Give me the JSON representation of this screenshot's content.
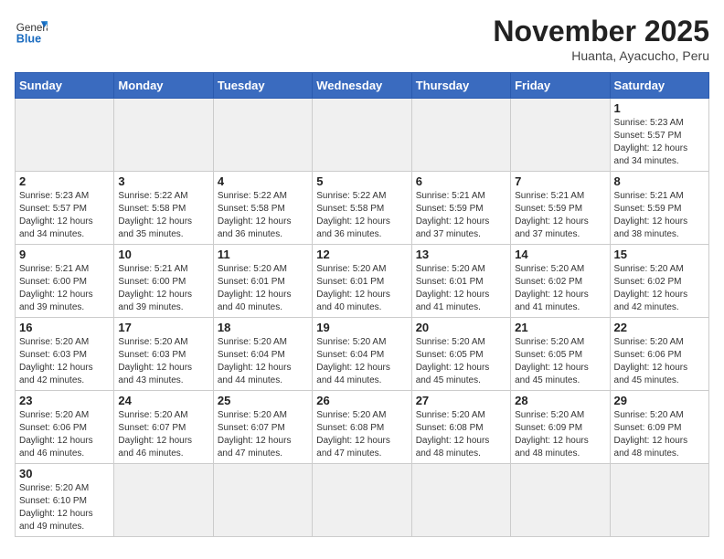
{
  "header": {
    "logo_general": "General",
    "logo_blue": "Blue",
    "month_title": "November 2025",
    "subtitle": "Huanta, Ayacucho, Peru"
  },
  "days_of_week": [
    "Sunday",
    "Monday",
    "Tuesday",
    "Wednesday",
    "Thursday",
    "Friday",
    "Saturday"
  ],
  "weeks": [
    [
      {
        "day": "",
        "info": ""
      },
      {
        "day": "",
        "info": ""
      },
      {
        "day": "",
        "info": ""
      },
      {
        "day": "",
        "info": ""
      },
      {
        "day": "",
        "info": ""
      },
      {
        "day": "",
        "info": ""
      },
      {
        "day": "1",
        "info": "Sunrise: 5:23 AM\nSunset: 5:57 PM\nDaylight: 12 hours and 34 minutes."
      }
    ],
    [
      {
        "day": "2",
        "info": "Sunrise: 5:23 AM\nSunset: 5:57 PM\nDaylight: 12 hours and 34 minutes."
      },
      {
        "day": "3",
        "info": "Sunrise: 5:22 AM\nSunset: 5:58 PM\nDaylight: 12 hours and 35 minutes."
      },
      {
        "day": "4",
        "info": "Sunrise: 5:22 AM\nSunset: 5:58 PM\nDaylight: 12 hours and 36 minutes."
      },
      {
        "day": "5",
        "info": "Sunrise: 5:22 AM\nSunset: 5:58 PM\nDaylight: 12 hours and 36 minutes."
      },
      {
        "day": "6",
        "info": "Sunrise: 5:21 AM\nSunset: 5:59 PM\nDaylight: 12 hours and 37 minutes."
      },
      {
        "day": "7",
        "info": "Sunrise: 5:21 AM\nSunset: 5:59 PM\nDaylight: 12 hours and 37 minutes."
      },
      {
        "day": "8",
        "info": "Sunrise: 5:21 AM\nSunset: 5:59 PM\nDaylight: 12 hours and 38 minutes."
      }
    ],
    [
      {
        "day": "9",
        "info": "Sunrise: 5:21 AM\nSunset: 6:00 PM\nDaylight: 12 hours and 39 minutes."
      },
      {
        "day": "10",
        "info": "Sunrise: 5:21 AM\nSunset: 6:00 PM\nDaylight: 12 hours and 39 minutes."
      },
      {
        "day": "11",
        "info": "Sunrise: 5:20 AM\nSunset: 6:01 PM\nDaylight: 12 hours and 40 minutes."
      },
      {
        "day": "12",
        "info": "Sunrise: 5:20 AM\nSunset: 6:01 PM\nDaylight: 12 hours and 40 minutes."
      },
      {
        "day": "13",
        "info": "Sunrise: 5:20 AM\nSunset: 6:01 PM\nDaylight: 12 hours and 41 minutes."
      },
      {
        "day": "14",
        "info": "Sunrise: 5:20 AM\nSunset: 6:02 PM\nDaylight: 12 hours and 41 minutes."
      },
      {
        "day": "15",
        "info": "Sunrise: 5:20 AM\nSunset: 6:02 PM\nDaylight: 12 hours and 42 minutes."
      }
    ],
    [
      {
        "day": "16",
        "info": "Sunrise: 5:20 AM\nSunset: 6:03 PM\nDaylight: 12 hours and 42 minutes."
      },
      {
        "day": "17",
        "info": "Sunrise: 5:20 AM\nSunset: 6:03 PM\nDaylight: 12 hours and 43 minutes."
      },
      {
        "day": "18",
        "info": "Sunrise: 5:20 AM\nSunset: 6:04 PM\nDaylight: 12 hours and 44 minutes."
      },
      {
        "day": "19",
        "info": "Sunrise: 5:20 AM\nSunset: 6:04 PM\nDaylight: 12 hours and 44 minutes."
      },
      {
        "day": "20",
        "info": "Sunrise: 5:20 AM\nSunset: 6:05 PM\nDaylight: 12 hours and 45 minutes."
      },
      {
        "day": "21",
        "info": "Sunrise: 5:20 AM\nSunset: 6:05 PM\nDaylight: 12 hours and 45 minutes."
      },
      {
        "day": "22",
        "info": "Sunrise: 5:20 AM\nSunset: 6:06 PM\nDaylight: 12 hours and 45 minutes."
      }
    ],
    [
      {
        "day": "23",
        "info": "Sunrise: 5:20 AM\nSunset: 6:06 PM\nDaylight: 12 hours and 46 minutes."
      },
      {
        "day": "24",
        "info": "Sunrise: 5:20 AM\nSunset: 6:07 PM\nDaylight: 12 hours and 46 minutes."
      },
      {
        "day": "25",
        "info": "Sunrise: 5:20 AM\nSunset: 6:07 PM\nDaylight: 12 hours and 47 minutes."
      },
      {
        "day": "26",
        "info": "Sunrise: 5:20 AM\nSunset: 6:08 PM\nDaylight: 12 hours and 47 minutes."
      },
      {
        "day": "27",
        "info": "Sunrise: 5:20 AM\nSunset: 6:08 PM\nDaylight: 12 hours and 48 minutes."
      },
      {
        "day": "28",
        "info": "Sunrise: 5:20 AM\nSunset: 6:09 PM\nDaylight: 12 hours and 48 minutes."
      },
      {
        "day": "29",
        "info": "Sunrise: 5:20 AM\nSunset: 6:09 PM\nDaylight: 12 hours and 48 minutes."
      }
    ],
    [
      {
        "day": "30",
        "info": "Sunrise: 5:20 AM\nSunset: 6:10 PM\nDaylight: 12 hours and 49 minutes."
      },
      {
        "day": "",
        "info": ""
      },
      {
        "day": "",
        "info": ""
      },
      {
        "day": "",
        "info": ""
      },
      {
        "day": "",
        "info": ""
      },
      {
        "day": "",
        "info": ""
      },
      {
        "day": "",
        "info": ""
      }
    ]
  ]
}
